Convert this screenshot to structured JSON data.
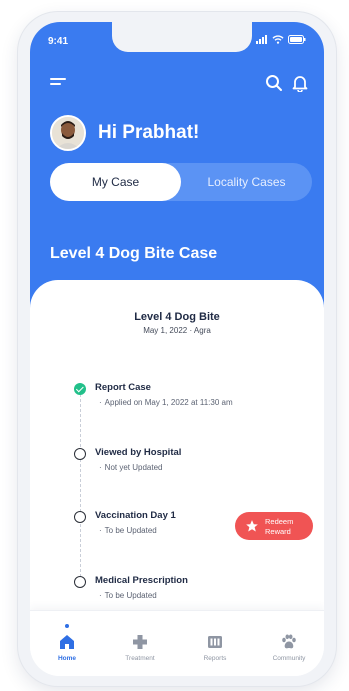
{
  "status": {
    "time": "9:41"
  },
  "header": {
    "greeting": "Hi Prabhat!"
  },
  "tabs": [
    {
      "label": "My Case",
      "active": true
    },
    {
      "label": "Locality Cases",
      "active": false
    }
  ],
  "case": {
    "heading": "Level 4 Dog Bite Case",
    "card_title": "Level 4 Dog Bite",
    "date": "May 1, 2022",
    "location": "Agra"
  },
  "steps": [
    {
      "title": "Report Case",
      "note": "Applied on May 1, 2022 at 11:30 am",
      "done": true
    },
    {
      "title": "Viewed by Hospital",
      "note": "Not yet Updated",
      "done": false
    },
    {
      "title": "Vaccination Day 1",
      "note": "To be Updated",
      "done": false
    },
    {
      "title": "Medical Prescription",
      "note": "To be Updated",
      "done": false
    }
  ],
  "redeem": {
    "line1": "Redeem",
    "line2": "Reward"
  },
  "bottom_nav": [
    {
      "label": "Home",
      "icon": "home-icon",
      "active": true
    },
    {
      "label": "Treatment",
      "icon": "medical-cross-icon",
      "active": false
    },
    {
      "label": "Reports",
      "icon": "reports-icon",
      "active": false
    },
    {
      "label": "Community",
      "icon": "paw-icon",
      "active": false
    }
  ],
  "colors": {
    "primary": "#3a7bf0",
    "success": "#22c08a",
    "danger": "#f05454"
  }
}
